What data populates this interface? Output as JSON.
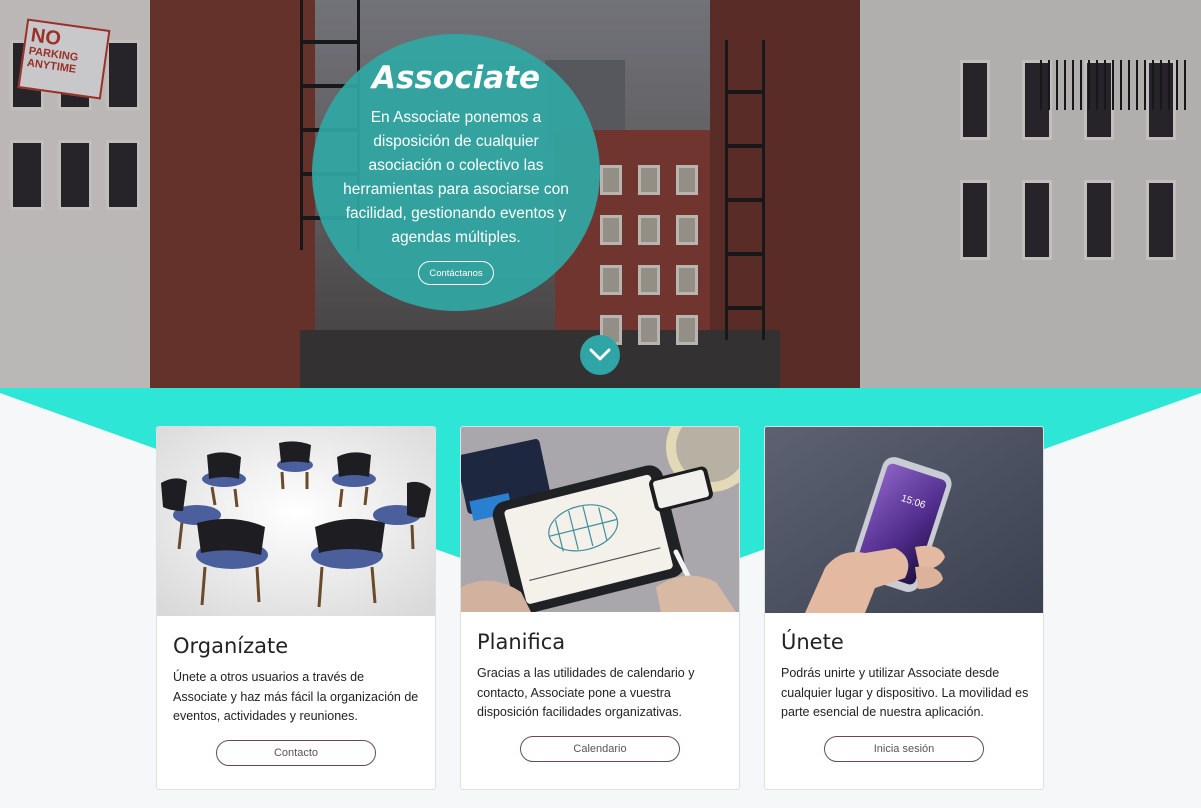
{
  "hero": {
    "sign_no": "NO",
    "sign_parking": "PARKING",
    "sign_anytime": "ANYTIME",
    "title": "Associate",
    "description": "En Associate ponemos a disposición de cualquier asociación o colectivo las herramientas para asociarse con facilidad, gestionando eventos y agendas múltiples.",
    "contact_label": "Contáctanos",
    "circle_color": "#30a8a4",
    "scroll_icon": "chevron-down-icon"
  },
  "accent_color": "#2ee6d6",
  "cards": [
    {
      "title": "Organízate",
      "text": "Únete a otros usuarios a través de Associate y haz más fácil la organización de eventos, actividades y reuniones.",
      "button": "Contacto"
    },
    {
      "title": "Planifica",
      "text": "Gracias a las utilidades de calendario y contacto, Associate pone a vuestra disposición facilidades organizativas.",
      "button": "Calendario"
    },
    {
      "title": "Únete",
      "text": "Podrás unirte y utilizar Associate desde cualquier lugar y dispositivo. La movilidad es parte esencial de nuestra aplicación.",
      "button": "Inicia sesión"
    }
  ]
}
